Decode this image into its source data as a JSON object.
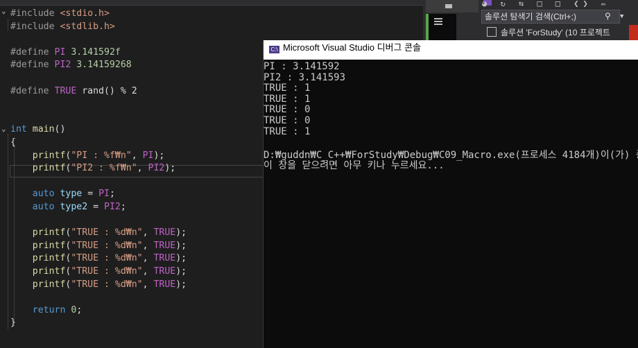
{
  "editor": {
    "lines": [
      {
        "parts": [
          {
            "c": "tok-pre",
            "t": "#include "
          },
          {
            "c": "tok-inc",
            "t": "<stdio.h>"
          }
        ]
      },
      {
        "parts": [
          {
            "c": "tok-pre",
            "t": "#include "
          },
          {
            "c": "tok-inc",
            "t": "<stdlib.h>"
          }
        ]
      },
      {
        "parts": []
      },
      {
        "parts": [
          {
            "c": "tok-pre",
            "t": "#define "
          },
          {
            "c": "tok-mac",
            "t": "PI"
          },
          {
            "c": "tok-num",
            "t": " 3.141592f"
          }
        ]
      },
      {
        "parts": [
          {
            "c": "tok-pre",
            "t": "#define "
          },
          {
            "c": "tok-mac",
            "t": "PI2"
          },
          {
            "c": "tok-num",
            "t": " 3.14159268"
          }
        ]
      },
      {
        "parts": []
      },
      {
        "parts": [
          {
            "c": "tok-pre",
            "t": "#define "
          },
          {
            "c": "tok-mac",
            "t": "TRUE"
          },
          {
            "c": "tok-plain",
            "t": " rand() % 2"
          }
        ]
      },
      {
        "parts": []
      },
      {
        "parts": []
      },
      {
        "parts": [
          {
            "c": "tok-kw",
            "t": "int"
          },
          {
            "c": "tok-plain",
            "t": " "
          },
          {
            "c": "tok-fn",
            "t": "main"
          },
          {
            "c": "tok-plain",
            "t": "()"
          }
        ]
      },
      {
        "parts": [
          {
            "c": "tok-plain",
            "t": "{"
          }
        ]
      },
      {
        "parts": [
          {
            "c": "tok-plain",
            "t": "    "
          },
          {
            "c": "tok-fn",
            "t": "printf"
          },
          {
            "c": "tok-plain",
            "t": "("
          },
          {
            "c": "tok-str",
            "t": "\"PI : %f₩n\""
          },
          {
            "c": "tok-plain",
            "t": ", "
          },
          {
            "c": "tok-mac",
            "t": "PI"
          },
          {
            "c": "tok-plain",
            "t": ");"
          }
        ]
      },
      {
        "parts": [
          {
            "c": "tok-plain",
            "t": "    "
          },
          {
            "c": "tok-fn",
            "t": "printf"
          },
          {
            "c": "tok-plain",
            "t": "("
          },
          {
            "c": "tok-str",
            "t": "\"PI2 : %f₩n\""
          },
          {
            "c": "tok-plain",
            "t": ", "
          },
          {
            "c": "tok-mac",
            "t": "PI2"
          },
          {
            "c": "tok-plain",
            "t": ");"
          }
        ]
      },
      {
        "parts": []
      },
      {
        "parts": [
          {
            "c": "tok-plain",
            "t": "    "
          },
          {
            "c": "tok-kw",
            "t": "auto"
          },
          {
            "c": "tok-plain",
            "t": " "
          },
          {
            "c": "tok-var",
            "t": "type"
          },
          {
            "c": "tok-plain",
            "t": " = "
          },
          {
            "c": "tok-mac",
            "t": "PI"
          },
          {
            "c": "tok-plain",
            "t": ";"
          }
        ]
      },
      {
        "parts": [
          {
            "c": "tok-plain",
            "t": "    "
          },
          {
            "c": "tok-kw",
            "t": "auto"
          },
          {
            "c": "tok-plain",
            "t": " "
          },
          {
            "c": "tok-var",
            "t": "type2"
          },
          {
            "c": "tok-plain",
            "t": " = "
          },
          {
            "c": "tok-mac",
            "t": "PI2"
          },
          {
            "c": "tok-plain",
            "t": ";"
          }
        ]
      },
      {
        "parts": []
      },
      {
        "parts": [
          {
            "c": "tok-plain",
            "t": "    "
          },
          {
            "c": "tok-fn",
            "t": "printf"
          },
          {
            "c": "tok-plain",
            "t": "("
          },
          {
            "c": "tok-str",
            "t": "\"TRUE : %d₩n\""
          },
          {
            "c": "tok-plain",
            "t": ", "
          },
          {
            "c": "tok-mac",
            "t": "TRUE"
          },
          {
            "c": "tok-plain",
            "t": ");"
          }
        ]
      },
      {
        "parts": [
          {
            "c": "tok-plain",
            "t": "    "
          },
          {
            "c": "tok-fn",
            "t": "printf"
          },
          {
            "c": "tok-plain",
            "t": "("
          },
          {
            "c": "tok-str",
            "t": "\"TRUE : %d₩n\""
          },
          {
            "c": "tok-plain",
            "t": ", "
          },
          {
            "c": "tok-mac",
            "t": "TRUE"
          },
          {
            "c": "tok-plain",
            "t": ");"
          }
        ]
      },
      {
        "parts": [
          {
            "c": "tok-plain",
            "t": "    "
          },
          {
            "c": "tok-fn",
            "t": "printf"
          },
          {
            "c": "tok-plain",
            "t": "("
          },
          {
            "c": "tok-str",
            "t": "\"TRUE : %d₩n\""
          },
          {
            "c": "tok-plain",
            "t": ", "
          },
          {
            "c": "tok-mac",
            "t": "TRUE"
          },
          {
            "c": "tok-plain",
            "t": ");"
          }
        ]
      },
      {
        "parts": [
          {
            "c": "tok-plain",
            "t": "    "
          },
          {
            "c": "tok-fn",
            "t": "printf"
          },
          {
            "c": "tok-plain",
            "t": "("
          },
          {
            "c": "tok-str",
            "t": "\"TRUE : %d₩n\""
          },
          {
            "c": "tok-plain",
            "t": ", "
          },
          {
            "c": "tok-mac",
            "t": "TRUE"
          },
          {
            "c": "tok-plain",
            "t": ");"
          }
        ]
      },
      {
        "parts": [
          {
            "c": "tok-plain",
            "t": "    "
          },
          {
            "c": "tok-fn",
            "t": "printf"
          },
          {
            "c": "tok-plain",
            "t": "("
          },
          {
            "c": "tok-str",
            "t": "\"TRUE : %d₩n\""
          },
          {
            "c": "tok-plain",
            "t": ", "
          },
          {
            "c": "tok-mac",
            "t": "TRUE"
          },
          {
            "c": "tok-plain",
            "t": ");"
          }
        ]
      },
      {
        "parts": []
      },
      {
        "parts": [
          {
            "c": "tok-plain",
            "t": "    "
          },
          {
            "c": "tok-kw",
            "t": "return"
          },
          {
            "c": "tok-plain",
            "t": " "
          },
          {
            "c": "tok-num",
            "t": "0"
          },
          {
            "c": "tok-plain",
            "t": ";"
          }
        ]
      },
      {
        "parts": [
          {
            "c": "tok-plain",
            "t": "}"
          }
        ]
      }
    ]
  },
  "vs": {
    "search_placeholder": "솔루션 탐색기 검색(Ctrl+;)",
    "solution_label": "솔루션 'ForStudy' (10 프로젝트"
  },
  "console": {
    "icon_label": "C:\\",
    "title": "Microsoft Visual Studio 디버그 콘솔",
    "lines": [
      "PI : 3.141592",
      "PI2 : 3.141593",
      "TRUE : 1",
      "TRUE : 1",
      "TRUE : 0",
      "TRUE : 0",
      "TRUE : 1",
      "",
      "D:₩guddn₩C_C++₩ForStudy₩Debug₩C09_Macro.exe(프로세스 4184개)이(가) 종",
      "이 창을 닫으려면 아무 키나 누르세요..."
    ]
  },
  "colors": {
    "editor_bg": "#1e1e1e",
    "console_bg": "#0c0c0c",
    "accent": "#7a4fbd"
  }
}
